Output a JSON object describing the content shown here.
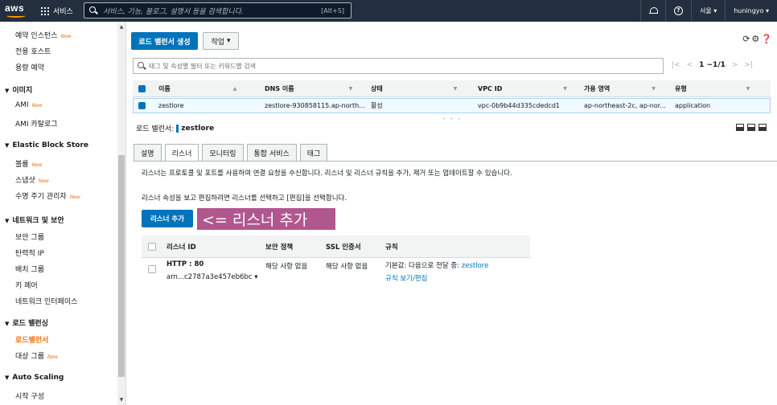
{
  "topbar": {
    "logo_text": "aws",
    "services_label": "서비스",
    "search_placeholder": "서비스, 기능, 블로그, 설명서 등을 검색합니다.",
    "search_shortcut": "[Alt+S]",
    "region": "서울 ▾",
    "user": "huningyo ▾"
  },
  "sidebar": {
    "items": [
      {
        "label": "예약 인스턴스",
        "new": "New"
      },
      {
        "label": "전용 호스트"
      },
      {
        "label": "용량 예약"
      },
      {
        "label": "이미지",
        "section": true
      },
      {
        "label": "AMI",
        "new": "New"
      },
      {
        "label": "AMI 카탈로그"
      },
      {
        "label": "Elastic Block Store",
        "section": true
      },
      {
        "label": "볼륨",
        "new": "New"
      },
      {
        "label": "스냅샷",
        "new": "New"
      },
      {
        "label": "수명 주기 관리자",
        "new": "New"
      },
      {
        "label": "네트워크 및 보안",
        "section": true
      },
      {
        "label": "보안 그룹"
      },
      {
        "label": "탄력적 IP"
      },
      {
        "label": "배치 그룹"
      },
      {
        "label": "키 페어"
      },
      {
        "label": "네트워크 인터페이스"
      },
      {
        "label": "로드 밸런싱",
        "section": true
      },
      {
        "label": "로드밸런서",
        "active": true
      },
      {
        "label": "대상 그룹",
        "new": "New"
      },
      {
        "label": "Auto Scaling",
        "section": true
      },
      {
        "label": "시작 구성"
      }
    ]
  },
  "toolbar": {
    "create_label": "로드 밸런서 생성",
    "action_label": "작업"
  },
  "filter": {
    "placeholder": "태그 및 속성별 필터 또는 키워드별 검색",
    "pagination": "1 ~1/1"
  },
  "grid": {
    "headers": [
      "이름",
      "DNS 이름",
      "상태",
      "VPC ID",
      "가용 영역",
      "유형"
    ],
    "row": [
      "zestlore",
      "zestlore-930858115.ap-north...",
      "활성",
      "vpc-0b9b44d335cdedcd1",
      "ap-northeast-2c, ap-nor...",
      "application"
    ]
  },
  "details": {
    "label": "로드 밸런서:",
    "name": "zestlore",
    "tabs": [
      "설명",
      "리스너",
      "모니터링",
      "통합 서비스",
      "태그"
    ],
    "active_tab": 1,
    "desc1": "리스너는 프로토콜 및 포트를 사용하여 연결 요청을 수신합니다. 리스너 및 리스너 규칙을 추가, 제거 또는 업데이트할 수 있습니다.",
    "desc2": "리스너 속성을 보고 편집하려면 리스너를 선택하고 [편집]을 선택합니다.",
    "add_listener_label": "리스너 추가",
    "annotation": "<= 리스너 추가"
  },
  "listeners": {
    "headers": [
      "리스너 ID",
      "보안 정책",
      "SSL 인증서",
      "규칙"
    ],
    "row": {
      "id": "HTTP : 80",
      "arn": "arn...c2787a3e457eb6bc ▾",
      "policy": "해당 사항 없음",
      "cert": "해당 사항 없음",
      "rule_prefix": "기본값:  다음으로 전달 중: ",
      "rule_target": "zestlore",
      "rule_link": "규칙 보기/편집"
    }
  },
  "colors": {
    "topbar_bg": "#232f3e",
    "primary": "#0073bb",
    "active_nav": "#ec7211",
    "annotation_bg": "#b0578f"
  }
}
